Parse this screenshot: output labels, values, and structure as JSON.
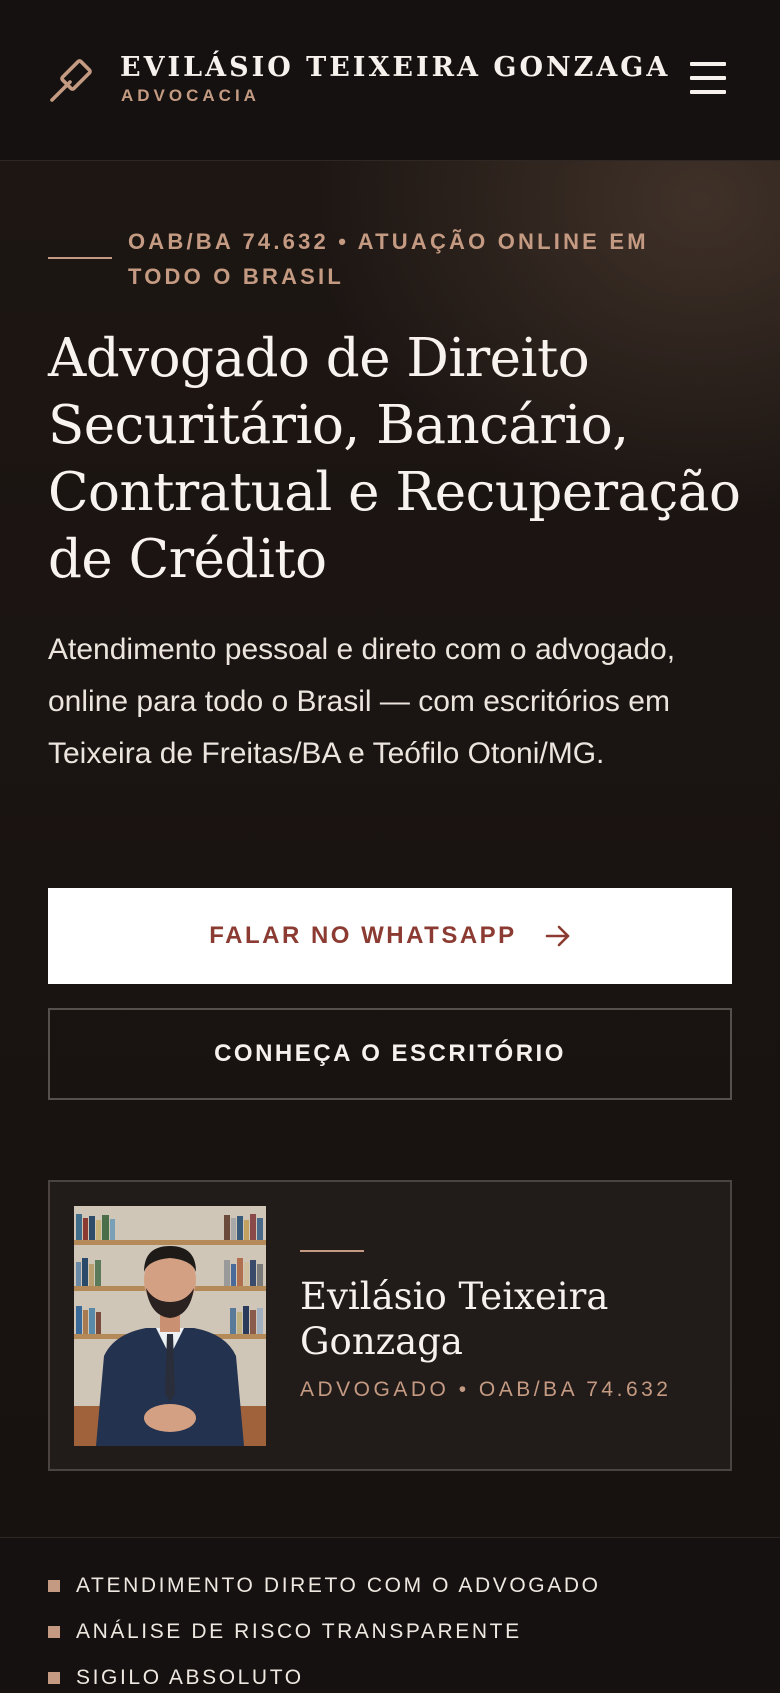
{
  "header": {
    "brand_name": "EVILÁSIO TEIXEIRA GONZAGA",
    "brand_sub": "ADVOCACIA",
    "logo_icon": "gavel-icon",
    "menu_icon": "hamburger-menu-icon"
  },
  "hero": {
    "eyebrow": "OAB/BA 74.632 • ATUAÇÃO ONLINE EM TODO O BRASIL",
    "headline": "Advogado de Direito Securitário, Bancário, Contratual e Recuperação de Crédito",
    "lead": "Atendimento pessoal e direto com o advogado, online para todo o Brasil — com escritórios em Teixeira de Freitas/BA e Teófilo Otoni/MG.",
    "primary_button": "FALAR NO WHATSAPP",
    "primary_button_icon": "arrow-right-icon",
    "secondary_button": "CONHEÇA O ESCRITÓRIO"
  },
  "profile": {
    "name": "Evilásio Teixeira Gonzaga",
    "role": "ADVOGADO • OAB/BA 74.632"
  },
  "features": [
    "ATENDIMENTO DIRETO COM O ADVOGADO",
    "ANÁLISE DE RISCO TRANSPARENTE",
    "SIGILO ABSOLUTO"
  ],
  "colors": {
    "background": "#181210",
    "accent": "#c49a82",
    "primary_button_text": "#8b3b32"
  }
}
